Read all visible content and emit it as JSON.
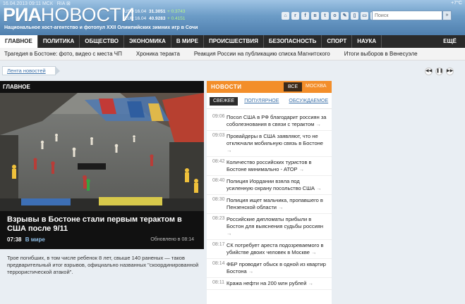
{
  "header": {
    "date": "16.04.2013",
    "time": "09:11 МСК",
    "rss": "RIA ⊠",
    "logo_bold": "РИА",
    "logo_rest": "НОВОСТИ",
    "tagline": "Национальное хост-агентство и фотопул XXII Олимпийских зимних игр в Сочи",
    "weather": "+7°С",
    "rates": [
      {
        "currency": "USD",
        "date": "16.04",
        "value": "31.3051",
        "change": "+ 0.3743"
      },
      {
        "currency": "EUR",
        "date": "16.04",
        "value": "40.9283",
        "change": "+ 0.4151"
      }
    ],
    "social_icons": [
      "home-icon",
      "rss-icon",
      "facebook-icon",
      "vk-icon",
      "twitter-icon",
      "odnoklassniki-icon",
      "livejournal-icon",
      "mobile-icon",
      "ipad-icon",
      "android-icon",
      "apple-icon"
    ],
    "search_placeholder": "Поиск",
    "search_button": "»"
  },
  "nav": {
    "items": [
      "ГЛАВНОЕ",
      "ПОЛИТИКА",
      "ОБЩЕСТВО",
      "ЭКОНОМИКА",
      "В МИРЕ",
      "ПРОИСШЕСТВИЯ",
      "БЕЗОПАСНОСТЬ",
      "СПОРТ",
      "НАУКА"
    ],
    "more": "ЕЩЁ"
  },
  "subnav": {
    "links": [
      "Трагедия в Бостоне: фото, видео с места ЧП",
      "Хроника теракта",
      "Реакция России на публикацию списка Магнитского",
      "Итоги выборов в Венесуэле"
    ]
  },
  "tape": {
    "label": "Лента новостей",
    "controls": [
      "◀◀",
      "❚❚",
      "▶▶"
    ]
  },
  "main": {
    "section_label": "ГЛАВНОЕ",
    "headline": "Взрывы в Бостоне стали первым терактом в США после 9/11",
    "time": "07:38",
    "rubric": "В мире",
    "updated": "Обновлено в 08:14",
    "lead": "Трое погибших, в том числе ребенок 8 лет, свыше 140 раненых — таков предварительный итог взрывов, официально названных \"скоординированной террористической атакой\"."
  },
  "news": {
    "title": "НОВОСТИ",
    "all_label": "ВСЕ",
    "moscow_label": "МОСКВА",
    "tabs": [
      "СВЕЖЕЕ",
      "ПОПУЛЯРНОЕ",
      "ОБСУЖДАЕМОЕ"
    ],
    "items": [
      {
        "time": "09:06",
        "title": "Посол США в РФ благодарит россиян за соболезнования в связи с терактом"
      },
      {
        "time": "09:03",
        "title": "Провайдеры в США заявляют, что не отключали мобильную связь в Бостоне"
      },
      {
        "time": "08:42",
        "title": "Количество российских туристов в Бостоне минимально - АТОР"
      },
      {
        "time": "08:40",
        "title": "Полиция Иордании взяла под усиленную охрану посольство США"
      },
      {
        "time": "08:30",
        "title": "Полиция ищет мальчика, пропавшего в Пензенской области"
      },
      {
        "time": "08:23",
        "title": "Российские дипломаты прибыли в Бостон для выяснения судьбы россиян"
      },
      {
        "time": "08:17",
        "title": "СК потребует ареста подозреваемого в убийстве двоих человек в Москве"
      },
      {
        "time": "08:14",
        "title": "ФБР проводит обыск в одной из квартир Бостона"
      },
      {
        "time": "08:11",
        "title": "Кража нефти на 200 млн рублей"
      }
    ]
  }
}
